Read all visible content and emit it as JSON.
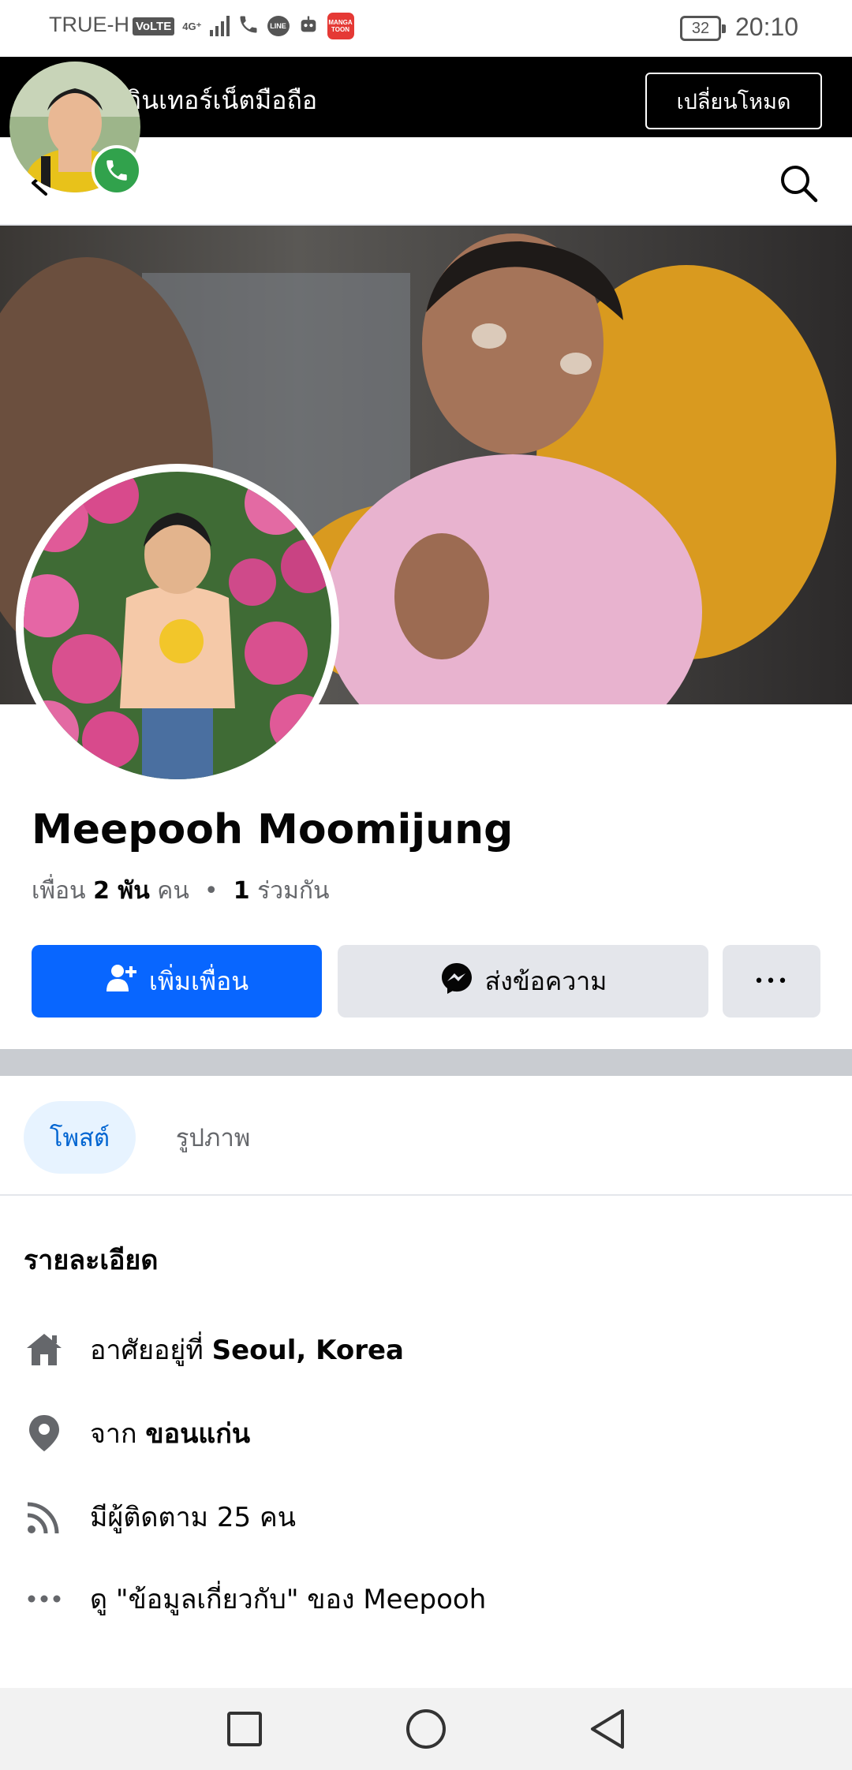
{
  "status_bar": {
    "carrier": "TRUE-H",
    "volte": "VoLTE",
    "network": "4G⁺",
    "app_icon_line": "LINE",
    "app_icon_manga": "MANGA TOON",
    "battery": "32",
    "time": "20:10"
  },
  "banner": {
    "text": "อินเทอร์เน็ตมือถือ",
    "mode_button": "เปลี่ยนโหมด"
  },
  "profile": {
    "name": "Meepooh Moomijung",
    "friends_prefix": "เพื่อน",
    "friends_count": "2 พัน",
    "friends_unit": "คน",
    "mutual_count": "1",
    "mutual_label": "ร่วมกัน"
  },
  "actions": {
    "add_friend": "เพิ่มเพื่อน",
    "message": "ส่งข้อความ",
    "more": "•••"
  },
  "tabs": [
    {
      "label": "โพสต์",
      "active": true
    },
    {
      "label": "รูปภาพ",
      "active": false
    }
  ],
  "details": {
    "title": "รายละเอียด",
    "lives_in_prefix": "อาศัยอยู่ที่",
    "lives_in_value": "Seoul, Korea",
    "from_prefix": "จาก",
    "from_value": "ขอนแก่น",
    "followers": "มีผู้ติดตาม 25 คน",
    "about": "ดู \"ข้อมูลเกี่ยวกับ\" ของ Meepooh"
  },
  "colors": {
    "primary": "#0866ff",
    "secondary_btn": "#e4e6eb",
    "divider": "#c9ccd1",
    "tab_active_bg": "#e7f3ff",
    "call_green": "#31a24c"
  },
  "icons": {
    "back": "back-arrow-icon",
    "search": "search-icon",
    "add_friend": "person-add-icon",
    "messenger": "messenger-icon",
    "home": "home-icon",
    "location": "location-pin-icon",
    "followers": "rss-feed-icon",
    "more": "more-dots-icon",
    "call": "phone-icon"
  }
}
